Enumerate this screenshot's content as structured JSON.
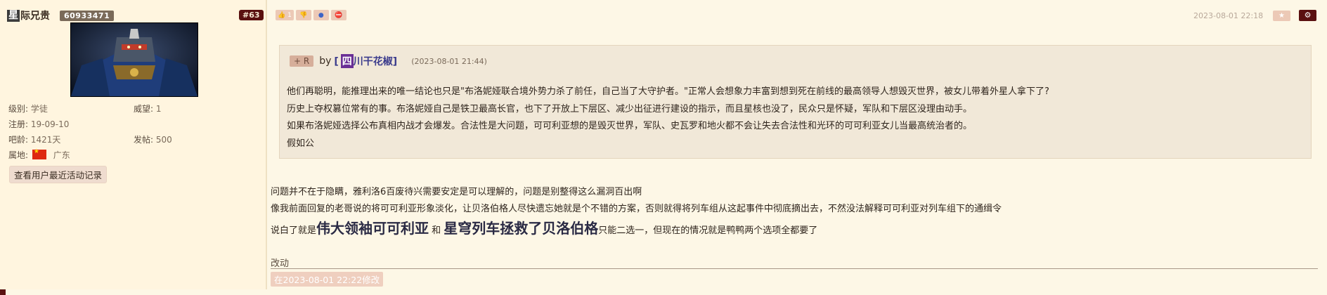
{
  "user": {
    "name_first": "星",
    "name_rest": "际兄贵",
    "uid": "60933471",
    "floor": "#63",
    "stats": {
      "level_label": "级别:",
      "level_value": "学徒",
      "prestige_label": "威望:",
      "prestige_value": "1",
      "register_label": "注册:",
      "register_value": "19-09-10",
      "age_label": "吧龄:",
      "age_value": "1421天",
      "posts_label": "发帖:",
      "posts_value": "500",
      "location_label": "属地:",
      "location_value": "广东"
    },
    "recent_button": "查看用户最近活动记录"
  },
  "topbar": {
    "like_count": "1",
    "date": "2023-08-01 22:18",
    "icons": [
      "thumbs-up-icon",
      "thumbs-down-icon",
      "tag-icon",
      "block-icon",
      "star-icon",
      "gear-icon"
    ]
  },
  "quote": {
    "plus_r": "+ R",
    "by": "by",
    "bracket_open": "[",
    "author_first": "四",
    "author_rest": "川干花椒",
    "bracket_close": "]",
    "date": "(2023-08-01 21:44)",
    "lines": [
      "他们再聪明，能推理出来的唯一结论也只是\"布洛妮娅联合境外势力杀了前任，自己当了大守护者。\"正常人会想象力丰富到想到死在前线的最高领导人想毁灭世界，被女儿带着外星人拿下了?",
      "历史上夺权篡位常有的事。布洛妮娅自己是铁卫最高长官，也下了开放上下层区、减少出征进行建设的指示，而且星核也没了，民众只是怀疑，军队和下层区没理由动手。",
      "如果布洛妮娅选择公布真相内战才会爆发。合法性是大问题，可可利亚想的是毁灭世界，军队、史瓦罗和地火都不会让失去合法性和光环的可可利亚女儿当最高统治者的。",
      "假如公"
    ]
  },
  "body": {
    "line1": "问题并不在于隐瞒，雅利洛6百废待兴需要安定是可以理解的，问题是别整得这么漏洞百出啊",
    "line2": "像我前面回复的老哥说的将可可利亚形象淡化，让贝洛伯格人尽快遗忘她就是个不错的方案，否则就得将列车组从这起事件中彻底摘出去，不然没法解释可可利亚对列车组下的通缉令",
    "line3_pre": "说白了就是",
    "line3_big1": "伟大领袖可可利亚",
    "line3_and": " 和 ",
    "line3_big2": "星穹列车拯救了贝洛伯格",
    "line3_post": "只能二选一，但现在的情况就是鸭鸭两个选项全都要了"
  },
  "edit": {
    "label": "改动",
    "date": "在2023-08-01 22:22修改"
  },
  "colors": {
    "background": "#fdf7e6",
    "sidebar": "#fff5df",
    "accent_dark": "#5a1010",
    "button_pink": "#ecc9b6",
    "quote_bg": "#f1e8d8"
  }
}
